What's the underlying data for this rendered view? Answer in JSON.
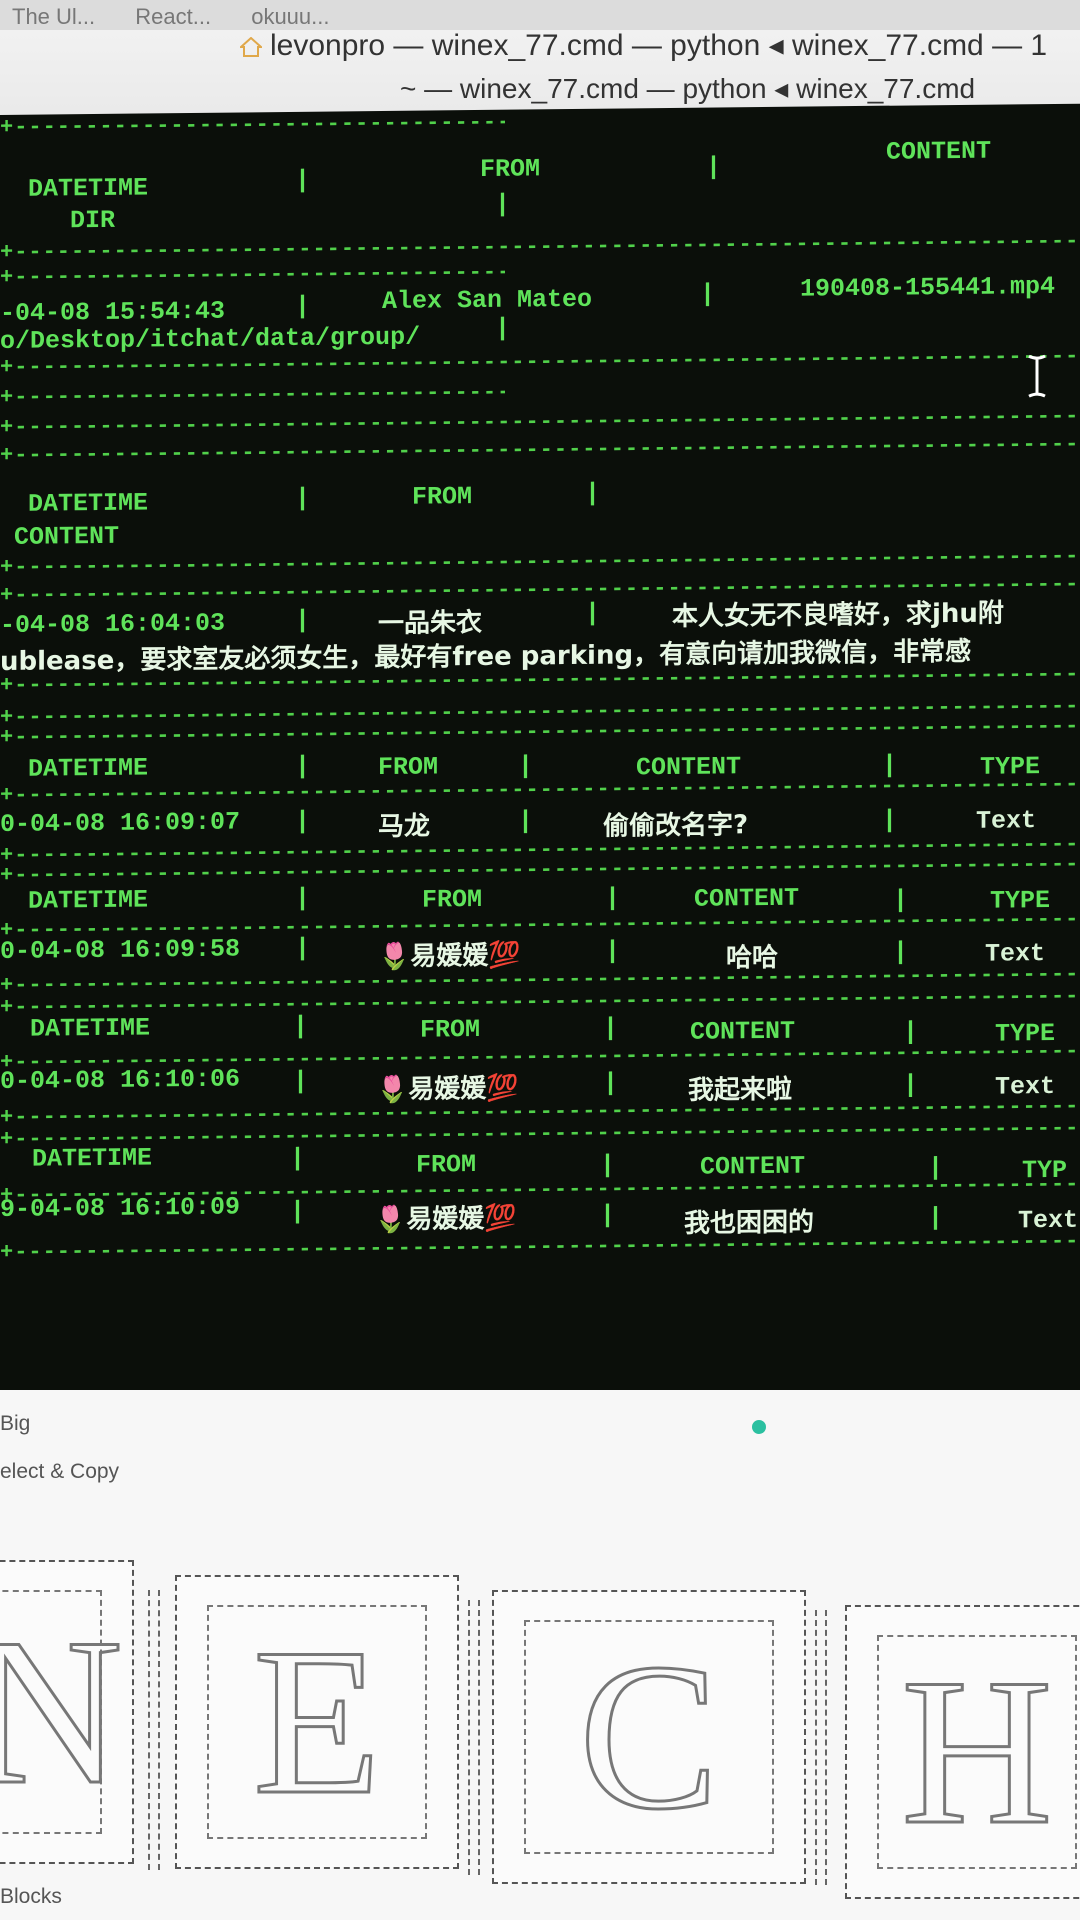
{
  "window": {
    "tabs": [
      "The Ul...",
      "React...",
      "okuuu..."
    ],
    "title": "levonpro — winex_77.cmd — python ◂ winex_77.cmd — 1",
    "subtitle": "~ — winex_77.cmd — python ◂ winex_77.cmd"
  },
  "terminal": {
    "block1": {
      "headers": [
        "DATETIME",
        "FROM",
        "CONTENT",
        "DIR"
      ],
      "row": [
        "-04-08 15:54:43",
        "Alex  San Mateo",
        "190408-155441.mp4",
        "o/Desktop/itchat/data/group/"
      ]
    },
    "block2": {
      "headers": [
        "DATETIME",
        "FROM",
        "CONTENT"
      ],
      "row": [
        "-04-08 16:04:03",
        "一品朱衣",
        "本人女无不良嗜好，求jhu附",
        "ublease，要求室友必须女生，最好有free parking，有意向请加我微信，非常感"
      ]
    },
    "block3": {
      "headers": [
        "DATETIME",
        "FROM",
        "CONTENT",
        "TYPE"
      ],
      "row": [
        "0-04-08 16:09:07",
        "马龙",
        "偷偷改名字?",
        "Text"
      ]
    },
    "block4": {
      "headers": [
        "DATETIME",
        "FROM",
        "CONTENT",
        "TYPE"
      ],
      "row": [
        "0-04-08 16:09:58",
        "🌷易媛媛💯",
        "哈哈",
        "Text"
      ]
    },
    "block5": {
      "headers": [
        "DATETIME",
        "FROM",
        "CONTENT",
        "TYPE"
      ],
      "row": [
        "0-04-08 16:10:06",
        "🌷易媛媛💯",
        "我起来啦",
        "Text"
      ]
    },
    "block6": {
      "headers": [
        "DATETIME",
        "FROM",
        "CONTENT",
        "TYP"
      ],
      "row": [
        "9-04-08 16:10:09",
        "🌷易媛媛💯",
        "我也困困的",
        "Text"
      ]
    },
    "separator": "+-----------------------------------------------------------------------------------------------------------+"
  },
  "panel": {
    "label1": "Big",
    "label2": "elect & Copy",
    "label3": "Blocks",
    "letters": [
      "N",
      "E",
      "C",
      "H"
    ]
  }
}
